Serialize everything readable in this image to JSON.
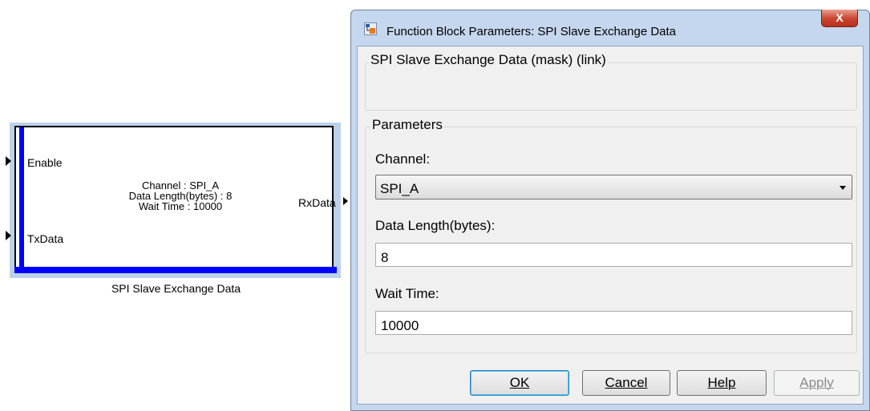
{
  "block": {
    "input_ports": [
      "Enable",
      "TxData"
    ],
    "output_port": "RxData",
    "lines": [
      "Channel : SPI_A",
      "Data Length(bytes) : 8",
      "Wait Time : 10000"
    ],
    "caption": "SPI Slave Exchange Data"
  },
  "dialog": {
    "title": "Function Block Parameters: SPI Slave Exchange Data",
    "close_label": "X",
    "description_title": "SPI Slave Exchange Data (mask) (link)",
    "parameters_title": "Parameters",
    "fields": {
      "channel": {
        "label": "Channel:",
        "value": "SPI_A"
      },
      "data_length": {
        "label": "Data Length(bytes):",
        "value": "8"
      },
      "wait_time": {
        "label": "Wait Time:",
        "value": "10000"
      }
    },
    "buttons": {
      "ok": "OK",
      "cancel": "Cancel",
      "help": "Help",
      "apply": "Apply"
    }
  },
  "colors": {
    "block_bar": "#0000ff",
    "dialog_frame": "#c5d7ee",
    "close_button": "#c8442d"
  }
}
